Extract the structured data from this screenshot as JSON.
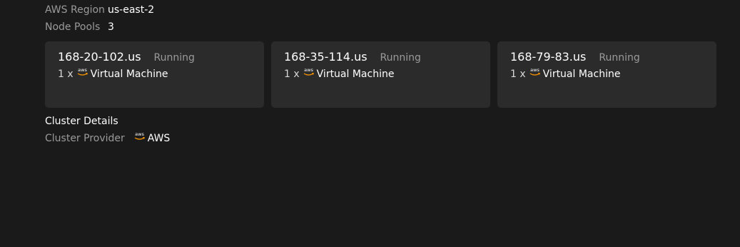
{
  "summary": {
    "region_label": "AWS Region",
    "region_value": "us-east-2",
    "pools_label": "Node Pools",
    "pools_value": "3"
  },
  "node_pools": [
    {
      "name": "168-20-102.us",
      "status": "Running",
      "count": "1 x",
      "provider_icon": "aws-logo-icon",
      "instance_type": "Virtual Machine"
    },
    {
      "name": "168-35-114.us",
      "status": "Running",
      "count": "1 x",
      "provider_icon": "aws-logo-icon",
      "instance_type": "Virtual Machine"
    },
    {
      "name": "168-79-83.us",
      "status": "Running",
      "count": "1 x",
      "provider_icon": "aws-logo-icon",
      "instance_type": "Virtual Machine"
    }
  ],
  "cluster_details": {
    "title": "Cluster Details",
    "provider_label": "Cluster Provider",
    "provider_icon": "aws-logo-icon",
    "provider_value": "AWS"
  },
  "colors": {
    "background": "#1a1a1a",
    "card_background": "#2b2b2b",
    "muted_text": "#9a9a9a",
    "aws_orange": "#f90"
  }
}
